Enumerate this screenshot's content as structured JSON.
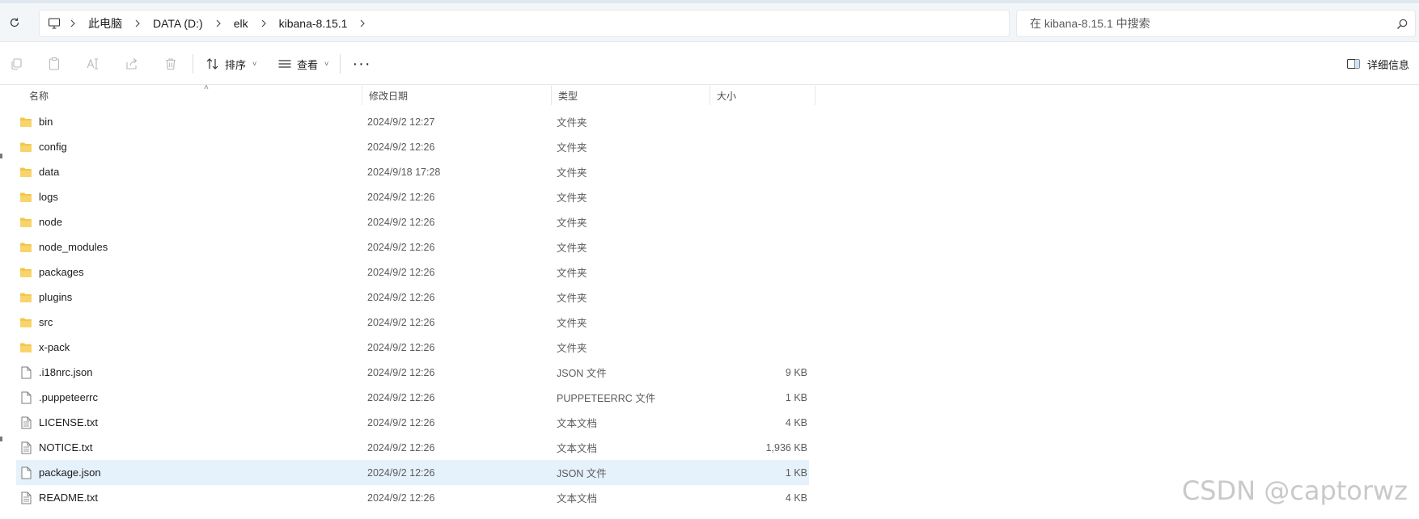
{
  "address": {
    "breadcrumb": [
      "此电脑",
      "DATA (D:)",
      "elk",
      "kibana-8.15.1"
    ],
    "search_placeholder": "在 kibana-8.15.1 中搜索"
  },
  "toolbar": {
    "sort_label": "排序",
    "view_label": "查看",
    "more_label": "···",
    "details_label": "详细信息"
  },
  "columns": {
    "name": "名称",
    "date": "修改日期",
    "type": "类型",
    "size": "大小"
  },
  "files": [
    {
      "name": "bin",
      "date": "2024/9/2 12:27",
      "type": "文件夹",
      "size": "",
      "icon": "folder-icon"
    },
    {
      "name": "config",
      "date": "2024/9/2 12:26",
      "type": "文件夹",
      "size": "",
      "icon": "folder-icon"
    },
    {
      "name": "data",
      "date": "2024/9/18 17:28",
      "type": "文件夹",
      "size": "",
      "icon": "folder-icon"
    },
    {
      "name": "logs",
      "date": "2024/9/2 12:26",
      "type": "文件夹",
      "size": "",
      "icon": "folder-icon"
    },
    {
      "name": "node",
      "date": "2024/9/2 12:26",
      "type": "文件夹",
      "size": "",
      "icon": "folder-icon"
    },
    {
      "name": "node_modules",
      "date": "2024/9/2 12:26",
      "type": "文件夹",
      "size": "",
      "icon": "folder-icon"
    },
    {
      "name": "packages",
      "date": "2024/9/2 12:26",
      "type": "文件夹",
      "size": "",
      "icon": "folder-icon"
    },
    {
      "name": "plugins",
      "date": "2024/9/2 12:26",
      "type": "文件夹",
      "size": "",
      "icon": "folder-icon"
    },
    {
      "name": "src",
      "date": "2024/9/2 12:26",
      "type": "文件夹",
      "size": "",
      "icon": "folder-icon"
    },
    {
      "name": "x-pack",
      "date": "2024/9/2 12:26",
      "type": "文件夹",
      "size": "",
      "icon": "folder-icon"
    },
    {
      "name": ".i18nrc.json",
      "date": "2024/9/2 12:26",
      "type": "JSON 文件",
      "size": "9 KB",
      "icon": "file-icon"
    },
    {
      "name": ".puppeteerrc",
      "date": "2024/9/2 12:26",
      "type": "PUPPETEERRC 文件",
      "size": "1 KB",
      "icon": "file-icon"
    },
    {
      "name": "LICENSE.txt",
      "date": "2024/9/2 12:26",
      "type": "文本文档",
      "size": "4 KB",
      "icon": "text-file-icon"
    },
    {
      "name": "NOTICE.txt",
      "date": "2024/9/2 12:26",
      "type": "文本文档",
      "size": "1,936 KB",
      "icon": "text-file-icon"
    },
    {
      "name": "package.json",
      "date": "2024/9/2 12:26",
      "type": "JSON 文件",
      "size": "1 KB",
      "icon": "file-icon",
      "selected": true
    },
    {
      "name": "README.txt",
      "date": "2024/9/2 12:26",
      "type": "文本文档",
      "size": "4 KB",
      "icon": "text-file-icon"
    }
  ],
  "watermark": "CSDN @captorwz",
  "colors": {
    "folder": "#f3c64b",
    "selected_row": "#e5f1fb",
    "address_bg": "#f3f6f9"
  }
}
